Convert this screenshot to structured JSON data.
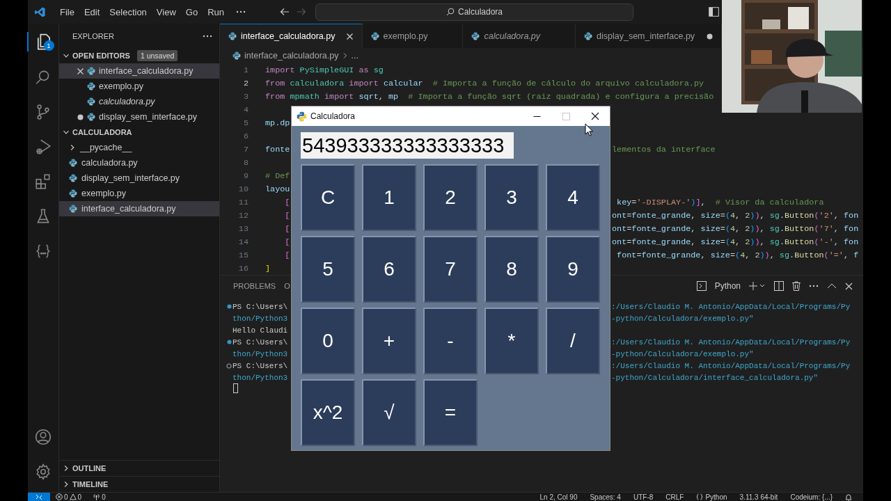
{
  "menu": [
    "File",
    "Edit",
    "Selection",
    "View",
    "Go",
    "Run"
  ],
  "command_center": {
    "label": "Calculadora"
  },
  "activity_bar": {
    "explorer_badge": "1"
  },
  "sidebar": {
    "title": "EXPLORER",
    "open_editors": {
      "title": "OPEN EDITORS",
      "expanded": true,
      "badge": "1 unsaved",
      "items": [
        {
          "name": "interface_calculadora.py",
          "selected": true,
          "preview": false,
          "modified": false
        },
        {
          "name": "exemplo.py",
          "selected": false,
          "preview": false,
          "modified": false
        },
        {
          "name": "calculadora.py",
          "selected": false,
          "preview": true,
          "modified": false
        },
        {
          "name": "display_sem_interface.py",
          "selected": false,
          "preview": false,
          "modified": true
        }
      ]
    },
    "folder": {
      "title": "CALCULADORA",
      "expanded": true,
      "items": [
        {
          "name": "__pycache__",
          "kind": "folder",
          "expanded": false,
          "selected": false
        },
        {
          "name": "calculadora.py",
          "kind": "file",
          "selected": false
        },
        {
          "name": "display_sem_interface.py",
          "kind": "file",
          "selected": false
        },
        {
          "name": "exemplo.py",
          "kind": "file",
          "selected": false
        },
        {
          "name": "interface_calculadora.py",
          "kind": "file",
          "selected": true
        }
      ]
    },
    "outline": {
      "title": "OUTLINE",
      "expanded": false
    },
    "timeline": {
      "title": "TIMELINE",
      "expanded": false
    }
  },
  "editor": {
    "tabs": [
      {
        "name": "interface_calculadora.py",
        "selected": true,
        "preview": false,
        "modified": false
      },
      {
        "name": "exemplo.py",
        "selected": false,
        "preview": false,
        "modified": false
      },
      {
        "name": "calculadora.py",
        "selected": false,
        "preview": true,
        "modified": false
      },
      {
        "name": "display_sem_interface.py",
        "selected": false,
        "preview": false,
        "modified": true
      }
    ],
    "breadcrumb": [
      "interface_calculadora.py",
      "..."
    ],
    "lines": [
      {
        "number": "1",
        "current": false,
        "left": [
          {
            "text": "import",
            "kind": "kw"
          },
          {
            "text": " PySimpleGUI",
            "kind": "mod"
          },
          {
            "text": " as",
            "kind": "kw"
          },
          {
            "text": " sg",
            "kind": "mod"
          }
        ]
      },
      {
        "number": "2",
        "current": true,
        "left": [
          {
            "text": "from",
            "kind": "kw"
          },
          {
            "text": " calculadora",
            "kind": "mod"
          },
          {
            "text": " import",
            "kind": "kw"
          },
          {
            "text": " calcular",
            "kind": "var"
          },
          {
            "text": "  # Importa a função de cálculo do arquivo calculadora.py",
            "kind": "cm"
          }
        ]
      },
      {
        "number": "3",
        "current": false,
        "left": [
          {
            "text": "from",
            "kind": "kw"
          },
          {
            "text": " mpmath",
            "kind": "mod"
          },
          {
            "text": " import",
            "kind": "kw"
          },
          {
            "text": " sqrt",
            "kind": "var"
          },
          {
            "text": ",",
            "kind": "p"
          },
          {
            "text": " mp",
            "kind": "var"
          },
          {
            "text": "  # Importa a função sqrt (raiz quadrada) e configura a precisão",
            "kind": "cm"
          }
        ]
      },
      {
        "number": "4",
        "current": false
      },
      {
        "number": "5",
        "current": false,
        "left": [
          {
            "text": "mp.dp",
            "kind": "var"
          }
        ]
      },
      {
        "number": "6",
        "current": false
      },
      {
        "number": "7",
        "current": false,
        "left": [
          {
            "text": "fonte",
            "kind": "var"
          }
        ],
        "right": [
          {
            "text": "lementos da interface",
            "kind": "cm"
          }
        ]
      },
      {
        "number": "8",
        "current": false
      },
      {
        "number": "9",
        "current": false,
        "left": [
          {
            "text": "# Def",
            "kind": "cm"
          }
        ]
      },
      {
        "number": "10",
        "current": false,
        "left": [
          {
            "text": "layou",
            "kind": "var"
          }
        ]
      },
      {
        "number": "11",
        "current": false,
        "left": [
          {
            "text": "    [",
            "kind": "b2"
          }
        ],
        "right": [
          {
            "text": " key",
            "kind": "var"
          },
          {
            "text": "=",
            "kind": "p"
          },
          {
            "text": "'-DISPLAY-'",
            "kind": "str"
          },
          {
            "text": ")",
            "kind": "b3"
          },
          {
            "text": "]",
            "kind": "b2"
          },
          {
            "text": ",",
            "kind": "p"
          },
          {
            "text": "  # Visor da calculadora",
            "kind": "cm"
          }
        ]
      },
      {
        "number": "12",
        "current": false,
        "left": [
          {
            "text": "    [",
            "kind": "b2"
          }
        ],
        "right": [
          {
            "text": "ont",
            "kind": "var"
          },
          {
            "text": "=",
            "kind": "p"
          },
          {
            "text": "fonte_grande",
            "kind": "var"
          },
          {
            "text": ",",
            "kind": "p"
          },
          {
            "text": " size",
            "kind": "var"
          },
          {
            "text": "=",
            "kind": "p"
          },
          {
            "text": "(",
            "kind": "b3"
          },
          {
            "text": "4",
            "kind": "num"
          },
          {
            "text": ",",
            "kind": "p"
          },
          {
            "text": " 2",
            "kind": "num"
          },
          {
            "text": ")",
            "kind": "b3"
          },
          {
            "text": ")",
            "kind": "b2"
          },
          {
            "text": ",",
            "kind": "p"
          },
          {
            "text": " sg",
            "kind": "mod"
          },
          {
            "text": ".",
            "kind": "p"
          },
          {
            "text": "Button",
            "kind": "fn"
          },
          {
            "text": "(",
            "kind": "b2"
          },
          {
            "text": "'2'",
            "kind": "str"
          },
          {
            "text": ",",
            "kind": "p"
          },
          {
            "text": " fon",
            "kind": "var"
          }
        ]
      },
      {
        "number": "13",
        "current": false,
        "left": [
          {
            "text": "    [",
            "kind": "b2"
          }
        ],
        "right": [
          {
            "text": "ont",
            "kind": "var"
          },
          {
            "text": "=",
            "kind": "p"
          },
          {
            "text": "fonte_grande",
            "kind": "var"
          },
          {
            "text": ",",
            "kind": "p"
          },
          {
            "text": " size",
            "kind": "var"
          },
          {
            "text": "=",
            "kind": "p"
          },
          {
            "text": "(",
            "kind": "b3"
          },
          {
            "text": "4",
            "kind": "num"
          },
          {
            "text": ",",
            "kind": "p"
          },
          {
            "text": " 2",
            "kind": "num"
          },
          {
            "text": ")",
            "kind": "b3"
          },
          {
            "text": ")",
            "kind": "b2"
          },
          {
            "text": ",",
            "kind": "p"
          },
          {
            "text": " sg",
            "kind": "mod"
          },
          {
            "text": ".",
            "kind": "p"
          },
          {
            "text": "Button",
            "kind": "fn"
          },
          {
            "text": "(",
            "kind": "b2"
          },
          {
            "text": "'7'",
            "kind": "str"
          },
          {
            "text": ",",
            "kind": "p"
          },
          {
            "text": " fon",
            "kind": "var"
          }
        ]
      },
      {
        "number": "14",
        "current": false,
        "left": [
          {
            "text": "    [",
            "kind": "b2"
          }
        ],
        "right": [
          {
            "text": "ont",
            "kind": "var"
          },
          {
            "text": "=",
            "kind": "p"
          },
          {
            "text": "fonte_grande",
            "kind": "var"
          },
          {
            "text": ",",
            "kind": "p"
          },
          {
            "text": " size",
            "kind": "var"
          },
          {
            "text": "=",
            "kind": "p"
          },
          {
            "text": "(",
            "kind": "b3"
          },
          {
            "text": "4",
            "kind": "num"
          },
          {
            "text": ",",
            "kind": "p"
          },
          {
            "text": " 2",
            "kind": "num"
          },
          {
            "text": ")",
            "kind": "b3"
          },
          {
            "text": ")",
            "kind": "b2"
          },
          {
            "text": ",",
            "kind": "p"
          },
          {
            "text": " sg",
            "kind": "mod"
          },
          {
            "text": ".",
            "kind": "p"
          },
          {
            "text": "Button",
            "kind": "fn"
          },
          {
            "text": "(",
            "kind": "b2"
          },
          {
            "text": "'-'",
            "kind": "str"
          },
          {
            "text": ",",
            "kind": "p"
          },
          {
            "text": " fon",
            "kind": "var"
          }
        ]
      },
      {
        "number": "15",
        "current": false,
        "left": [
          {
            "text": "    [",
            "kind": "b2"
          }
        ],
        "right": [
          {
            "text": " font",
            "kind": "var"
          },
          {
            "text": "=",
            "kind": "p"
          },
          {
            "text": "fonte_grande",
            "kind": "var"
          },
          {
            "text": ",",
            "kind": "p"
          },
          {
            "text": " size",
            "kind": "var"
          },
          {
            "text": "=",
            "kind": "p"
          },
          {
            "text": "(",
            "kind": "b3"
          },
          {
            "text": "4",
            "kind": "num"
          },
          {
            "text": ",",
            "kind": "p"
          },
          {
            "text": " 2",
            "kind": "num"
          },
          {
            "text": ")",
            "kind": "b3"
          },
          {
            "text": ")",
            "kind": "b2"
          },
          {
            "text": ",",
            "kind": "p"
          },
          {
            "text": " sg",
            "kind": "mod"
          },
          {
            "text": ".",
            "kind": "p"
          },
          {
            "text": "Button",
            "kind": "fn"
          },
          {
            "text": "(",
            "kind": "b2"
          },
          {
            "text": "'='",
            "kind": "str"
          },
          {
            "text": ",",
            "kind": "p"
          },
          {
            "text": " f",
            "kind": "var"
          }
        ]
      },
      {
        "number": "16",
        "current": false,
        "left": [
          {
            "text": "]",
            "kind": "b1"
          }
        ]
      }
    ]
  },
  "panel": {
    "tabs": [
      {
        "label": "PROBLEMS",
        "selected": false
      },
      {
        "label": "O",
        "selected": false
      }
    ],
    "terminal_name": "Python",
    "lines": [
      {
        "kind": "dot",
        "left": [
          {
            "text": "PS C:\\Users\\",
            "kind": "t"
          }
        ],
        "right": [
          {
            "text": ":/Users/Claudio M. Antonio/AppData/Local/Programs/Py",
            "kind": "path"
          }
        ]
      },
      {
        "kind": "plain",
        "left": [
          {
            "text": "thon/Python3",
            "kind": "path"
          }
        ],
        "right": [
          {
            "text": "-python/Calculadora/exemplo.py\"",
            "kind": "path"
          }
        ]
      },
      {
        "kind": "plain",
        "left": [
          {
            "text": "Hello Claudi",
            "kind": "t"
          }
        ]
      },
      {
        "kind": "dot",
        "left": [
          {
            "text": "PS C:\\Users\\",
            "kind": "t"
          }
        ],
        "right": [
          {
            "text": ":/Users/Claudio M. Antonio/AppData/Local/Programs/Py",
            "kind": "path"
          }
        ]
      },
      {
        "kind": "plain",
        "left": [
          {
            "text": "thon/Python3",
            "kind": "path"
          }
        ],
        "right": [
          {
            "text": "-python/Calculadora/exemplo.py\"",
            "kind": "path"
          }
        ]
      },
      {
        "kind": "ring",
        "left": [
          {
            "text": "PS C:\\Users\\",
            "kind": "t"
          }
        ],
        "right": [
          {
            "text": ":/Users/Claudio M. Antonio/AppData/Local/Programs/Py",
            "kind": "path"
          }
        ]
      },
      {
        "kind": "plain",
        "left": [
          {
            "text": "thon/Python3",
            "kind": "path"
          }
        ],
        "right": [
          {
            "text": "-python/Calculadora/interface_calculadora.py\"",
            "kind": "path"
          }
        ]
      }
    ]
  },
  "status_bar": {
    "errors": "0",
    "warnings": "0",
    "ports": "0",
    "items": [
      "Ln 2, Col 90",
      "Spaces: 4",
      "UTF-8",
      "CRLF",
      "Python",
      "3.11.3 64-bit",
      "Codeium: {...}"
    ]
  },
  "calculator": {
    "title": "Calculadora",
    "maximize_disabled": true,
    "display": "543933333333333333",
    "keys": [
      [
        "C",
        "1",
        "2",
        "3",
        "4"
      ],
      [
        "5",
        "6",
        "7",
        "8",
        "9"
      ],
      [
        "0",
        "+",
        "-",
        "*",
        "/"
      ],
      [
        "x^2",
        "√",
        "="
      ]
    ]
  }
}
